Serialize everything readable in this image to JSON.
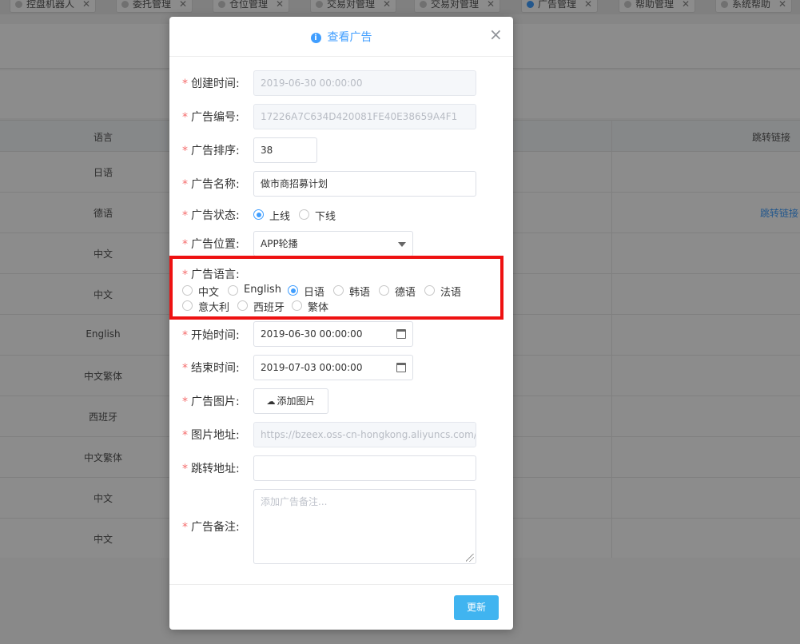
{
  "tabs": [
    {
      "label": "控盘机器人",
      "active": false
    },
    {
      "label": "委托管理",
      "active": false
    },
    {
      "label": "仓位管理",
      "active": false
    },
    {
      "label": "交易对管理",
      "active": false
    },
    {
      "label": "交易对管理",
      "active": false
    },
    {
      "label": "广告管理",
      "active": true
    },
    {
      "label": "帮助管理",
      "active": false
    },
    {
      "label": "系统帮助",
      "active": false
    }
  ],
  "table": {
    "header_lang": "语言",
    "header_link": "跳转链接",
    "rows": [
      {
        "lang": "日语",
        "link": ""
      },
      {
        "lang": "德语",
        "link": "跳转链接"
      },
      {
        "lang": "中文",
        "link": ""
      },
      {
        "lang": "中文",
        "link": ""
      },
      {
        "lang": "English",
        "link": ""
      },
      {
        "lang": "中文繁体",
        "link": ""
      },
      {
        "lang": "西班牙",
        "link": ""
      },
      {
        "lang": "中文繁体",
        "link": ""
      },
      {
        "lang": "中文",
        "link": ""
      },
      {
        "lang": "中文",
        "link": ""
      }
    ]
  },
  "dialog": {
    "title": "查看广告",
    "info_icon": "i",
    "close_icon": "×",
    "required_mark": "*",
    "fields": {
      "created_time": {
        "label": "创建时间:",
        "value": "2019-06-30 00:00:00"
      },
      "ad_id": {
        "label": "广告编号:",
        "value": "17226A7C634D420081FE40E38659A4F1"
      },
      "sort": {
        "label": "广告排序:",
        "value": "38"
      },
      "name": {
        "label": "广告名称:",
        "value": "做市商招募计划"
      },
      "status": {
        "label": "广告状态:",
        "options": [
          "上线",
          "下线"
        ],
        "selected": "上线"
      },
      "position": {
        "label": "广告位置:",
        "value": "APP轮播"
      },
      "language": {
        "label": "广告语言:",
        "options": [
          "中文",
          "English",
          "日语",
          "韩语",
          "德语",
          "法语",
          "意大利",
          "西班牙",
          "繁体"
        ],
        "selected": "日语"
      },
      "start_time": {
        "label": "开始时间:",
        "value": "2019-06-30 00:00:00"
      },
      "end_time": {
        "label": "结束时间:",
        "value": "2019-07-03 00:00:00"
      },
      "image": {
        "label": "广告图片:",
        "button": "添加图片"
      },
      "image_url": {
        "label": "图片地址:",
        "value": "https://bzeex.oss-cn-hongkong.aliyuncs.com/sys"
      },
      "redirect_url": {
        "label": "跳转地址:",
        "value": ""
      },
      "remark": {
        "label": "广告备注:",
        "placeholder": "添加广告备注..."
      }
    },
    "update_button": "更新"
  },
  "colors": {
    "primary": "#409eff",
    "update_button": "#40b4f0",
    "highlight": "#ee1111",
    "required": "#f56c6c"
  }
}
